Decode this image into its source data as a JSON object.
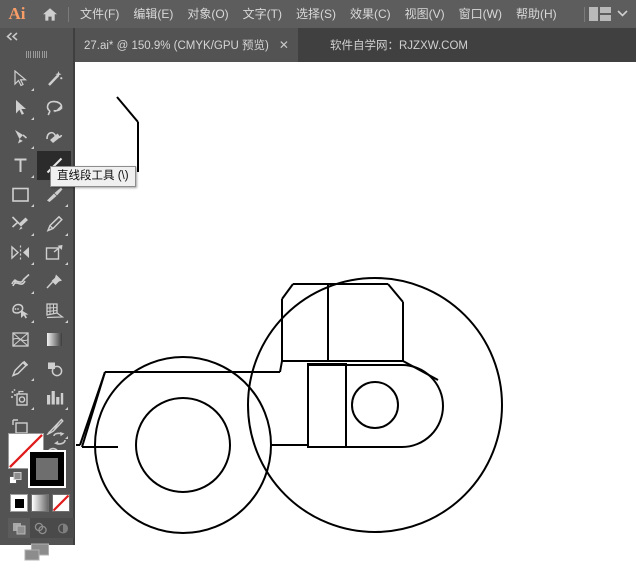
{
  "app": {
    "logo_text": "Ai",
    "home_icon": "home-icon",
    "panel_layout_icon": "panel-layout-icon",
    "chevron_icon": "⌄",
    "bg_color": "#535353",
    "menubar_color": "#5d5d5d",
    "accent_color": "#f79d68"
  },
  "menu": {
    "items": [
      {
        "label": "文件(F)",
        "name": "menu-file"
      },
      {
        "label": "编辑(E)",
        "name": "menu-edit"
      },
      {
        "label": "对象(O)",
        "name": "menu-object"
      },
      {
        "label": "文字(T)",
        "name": "menu-type"
      },
      {
        "label": "选择(S)",
        "name": "menu-select"
      },
      {
        "label": "效果(C)",
        "name": "menu-effect"
      },
      {
        "label": "视图(V)",
        "name": "menu-view"
      },
      {
        "label": "窗口(W)",
        "name": "menu-window"
      },
      {
        "label": "帮助(H)",
        "name": "menu-help"
      }
    ]
  },
  "tabs": {
    "active": {
      "title": "27.ai* @ 150.9% (CMYK/GPU 预览)",
      "close_label": "✕"
    },
    "note": "软件自学网：RJZXW.COM"
  },
  "toolpanel": {
    "collapse_label": "◂◂",
    "grip": "panel-grip",
    "tools": [
      {
        "name": "selection-tool",
        "icon": "cursor-arrow-outline-icon",
        "selected": false,
        "has_flyout": true
      },
      {
        "name": "magic-wand-tool",
        "icon": "magic-wand-icon",
        "selected": false,
        "has_flyout": false
      },
      {
        "name": "direct-selection-tool",
        "icon": "cursor-arrow-solid-icon",
        "selected": false,
        "has_flyout": true
      },
      {
        "name": "lasso-tool",
        "icon": "lasso-icon",
        "selected": false,
        "has_flyout": false
      },
      {
        "name": "pen-tool",
        "icon": "pen-nib-icon",
        "selected": false,
        "has_flyout": true
      },
      {
        "name": "curvature-tool",
        "icon": "curvature-pen-icon",
        "selected": false,
        "has_flyout": false
      },
      {
        "name": "type-tool",
        "icon": "type-T-icon",
        "selected": false,
        "has_flyout": true
      },
      {
        "name": "line-segment-tool",
        "icon": "diagonal-line-icon",
        "selected": true,
        "has_flyout": true
      },
      {
        "name": "rectangle-tool",
        "icon": "rectangle-icon",
        "selected": false,
        "has_flyout": true
      },
      {
        "name": "paintbrush-tool",
        "icon": "paintbrush-icon",
        "selected": false,
        "has_flyout": true
      },
      {
        "name": "shaper-tool",
        "icon": "shaper-pencil-icon",
        "selected": false,
        "has_flyout": true
      },
      {
        "name": "pencil-tool",
        "icon": "pencil-icon",
        "selected": false,
        "has_flyout": true
      },
      {
        "name": "rotate-reflect-tool",
        "icon": "reflect-icon",
        "selected": false,
        "has_flyout": true
      },
      {
        "name": "scale-tool",
        "icon": "scale-arrow-icon",
        "selected": false,
        "has_flyout": true
      },
      {
        "name": "width-tool",
        "icon": "width-warp-icon",
        "selected": false,
        "has_flyout": true
      },
      {
        "name": "free-transform-tool",
        "icon": "pushpin-icon",
        "selected": false,
        "has_flyout": false
      },
      {
        "name": "shape-builder-tool",
        "icon": "shape-builder-icon",
        "selected": false,
        "has_flyout": true
      },
      {
        "name": "perspective-grid-tool",
        "icon": "perspective-grid-icon",
        "selected": false,
        "has_flyout": true
      },
      {
        "name": "mesh-tool",
        "icon": "mesh-icon",
        "selected": false,
        "has_flyout": false
      },
      {
        "name": "gradient-tool",
        "icon": "gradient-square-icon",
        "selected": false,
        "has_flyout": false
      },
      {
        "name": "eyedropper-tool",
        "icon": "eyedropper-icon",
        "selected": false,
        "has_flyout": true
      },
      {
        "name": "blend-tool",
        "icon": "blend-icon",
        "selected": false,
        "has_flyout": false
      },
      {
        "name": "symbol-sprayer-tool",
        "icon": "symbol-sprayer-icon",
        "selected": false,
        "has_flyout": true
      },
      {
        "name": "column-graph-tool",
        "icon": "bar-graph-icon",
        "selected": false,
        "has_flyout": true
      },
      {
        "name": "artboard-tool",
        "icon": "artboard-icon",
        "selected": false,
        "has_flyout": false
      },
      {
        "name": "slice-tool",
        "icon": "slice-knife-icon",
        "selected": false,
        "has_flyout": true
      },
      {
        "name": "hand-tool",
        "icon": "hand-icon",
        "selected": false,
        "has_flyout": true
      },
      {
        "name": "zoom-tool",
        "icon": "magnifier-icon",
        "selected": false,
        "has_flyout": false
      }
    ],
    "color": {
      "fill_label": "none",
      "fill_color": "#ffffff",
      "stroke_color": "#000000",
      "none_slash_color": "#e01b1b",
      "swap_icon": "swap-fill-stroke-icon",
      "default_icon": "default-fill-stroke-icon",
      "modes": [
        {
          "name": "color-mode-button",
          "icon": "solid-color-icon",
          "active": true
        },
        {
          "name": "gradient-mode-button",
          "icon": "gradient-icon",
          "active": false
        },
        {
          "name": "none-mode-button",
          "icon": "none-icon",
          "active": false
        }
      ],
      "draw_modes": [
        {
          "name": "draw-normal-button",
          "icon": "draw-normal-icon",
          "active": true
        },
        {
          "name": "draw-behind-button",
          "icon": "draw-behind-icon",
          "active": false
        },
        {
          "name": "draw-inside-button",
          "icon": "draw-inside-icon",
          "active": false
        }
      ],
      "screen_mode": {
        "name": "change-screen-mode-button",
        "icon": "screen-mode-icon"
      }
    }
  },
  "tooltip": {
    "text": "直线段工具 (\\)"
  },
  "artwork": {
    "title": "road-roller-line-drawing",
    "stroke_color": "#000000",
    "stroke_width": 2,
    "shapes": [
      {
        "name": "cab-roof-left-post",
        "type": "line"
      },
      {
        "name": "cab-divider",
        "type": "line"
      },
      {
        "name": "cab-roof-right-post",
        "type": "line"
      },
      {
        "name": "exhaust-stack",
        "type": "polyline"
      },
      {
        "name": "hood-body",
        "type": "polyline"
      },
      {
        "name": "front-wheel-outer",
        "type": "circle"
      },
      {
        "name": "front-wheel-inner",
        "type": "circle"
      },
      {
        "name": "roller-outer",
        "type": "circle"
      },
      {
        "name": "roller-frame",
        "type": "rounded-rect"
      },
      {
        "name": "roller-hub",
        "type": "circle"
      },
      {
        "name": "axle-bar",
        "type": "rect"
      },
      {
        "name": "axle-link",
        "type": "line"
      },
      {
        "name": "rear-fender-arm",
        "type": "line"
      }
    ]
  }
}
